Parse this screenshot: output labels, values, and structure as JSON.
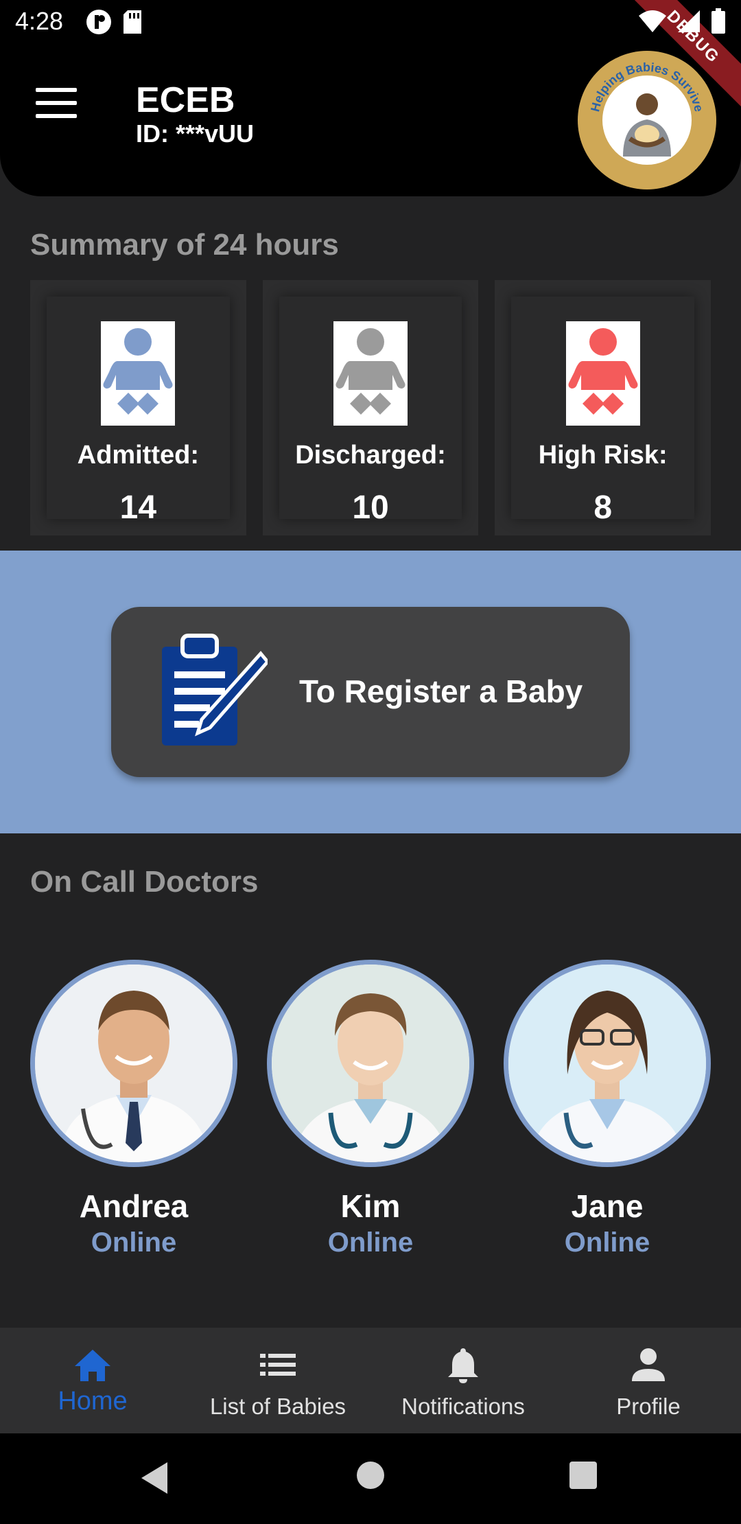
{
  "status_bar": {
    "time": "4:28"
  },
  "header": {
    "title": "ECEB",
    "id_text": "ID: ***vUU",
    "logo_text": "Helping Babies Survive",
    "debug_label": "DEBUG"
  },
  "summary": {
    "title": "Summary of 24 hours",
    "cards": [
      {
        "label": "Admitted:",
        "value": "14",
        "color": "#7f9ccb"
      },
      {
        "label": "Discharged:",
        "value": "10",
        "color": "#9b9b9b"
      },
      {
        "label": "High Risk:",
        "value": "8",
        "color": "#f45b5b"
      }
    ]
  },
  "register": {
    "label": "To Register a Baby"
  },
  "doctors": {
    "title": "On Call Doctors",
    "items": [
      {
        "name": "Andrea",
        "status": "Online"
      },
      {
        "name": "Kim",
        "status": "Online"
      },
      {
        "name": "Jane",
        "status": "Online"
      }
    ]
  },
  "bottom_nav": {
    "items": [
      {
        "label": "Home",
        "icon": "home-icon"
      },
      {
        "label": "List of Babies",
        "icon": "list-icon"
      },
      {
        "label": "Notifications",
        "icon": "bell-icon"
      },
      {
        "label": "Profile",
        "icon": "person-icon"
      }
    ],
    "active_index": 0,
    "active_color": "#1f66d1"
  }
}
